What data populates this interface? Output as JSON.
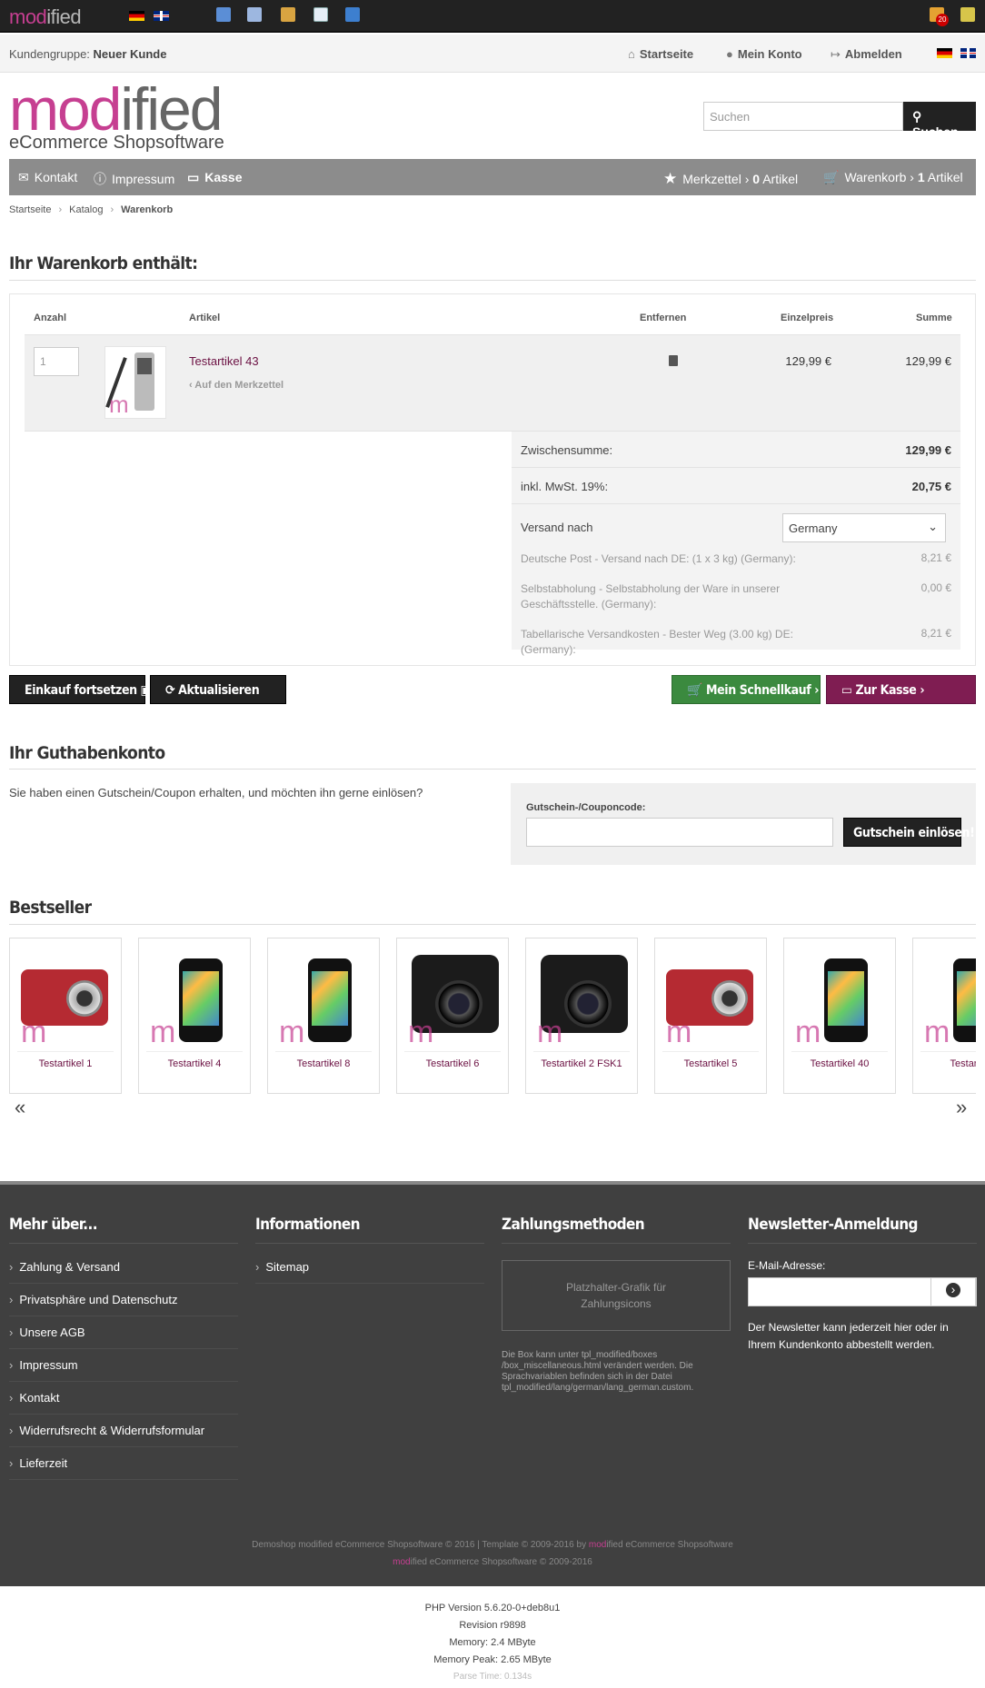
{
  "admin_bar": {
    "logo_left": "mod",
    "logo_right": "ified",
    "badge": "20"
  },
  "topbar": {
    "group_label": "Kundengruppe:",
    "group_value": "Neuer Kunde",
    "links": [
      "Startseite",
      "Mein Konto",
      "Abmelden"
    ]
  },
  "header": {
    "logo_main_a": "mod",
    "logo_main_b": "ified",
    "logo_sub": "eCommerce Shopsoftware",
    "search_placeholder": "Suchen",
    "search_button": "Suchen"
  },
  "nav": {
    "left": [
      "Kontakt",
      "Impressum",
      "Kasse"
    ],
    "merkzettel_label": "Merkzettel",
    "merkzettel_count": "0",
    "merkzettel_unit": "Artikel",
    "cart_label": "Warenkorb",
    "cart_count": "1",
    "cart_unit": "Artikel"
  },
  "breadcrumb": [
    "Startseite",
    "Katalog",
    "Warenkorb"
  ],
  "cart": {
    "title": "Ihr Warenkorb enthält:",
    "headers": {
      "qty": "Anzahl",
      "article": "Artikel",
      "remove": "Entfernen",
      "unit_price": "Einzelpreis",
      "sum": "Summe"
    },
    "item": {
      "qty": "1",
      "name": "Testartikel 43",
      "merkzettel_link": "‹ Auf den Merkzettel",
      "unit_price": "129,99 €",
      "sum": "129,99 €"
    },
    "subtotal_label": "Zwischensumme:",
    "subtotal_value": "129,99 €",
    "tax_label": "inkl. MwSt. 19%:",
    "tax_value": "20,75 €",
    "shipping_label": "Versand nach",
    "shipping_country": "Germany",
    "shipping_options": [
      {
        "text": "Deutsche Post - Versand nach DE: (1 x 3 kg) (Germany):",
        "value": "8,21 €"
      },
      {
        "text": "Selbstabholung - Selbstabholung der Ware in unserer Geschäftsstelle. (Germany):",
        "value": "0,00 €"
      },
      {
        "text": "Tabellarische Versandkosten - Bester Weg (3.00 kg) DE: (Germany):",
        "value": "8,21 €"
      }
    ]
  },
  "buttons": {
    "continue": "Einkauf fortsetzen",
    "update": "Aktualisieren",
    "quickbuy": "Mein Schnellkauf ›",
    "checkout": "Zur Kasse ›"
  },
  "coupon": {
    "title": "Ihr Guthabenkonto",
    "text": "Sie haben einen Gutschein/Coupon erhalten, und möchten ihn gerne einlösen?",
    "field_label": "Gutschein-/Couponcode:",
    "button": "Gutschein einlösen!"
  },
  "bestseller": {
    "title": "Bestseller",
    "items": [
      "Testartikel 1",
      "Testartikel 4",
      "Testartikel 8",
      "Testartikel 6",
      "Testartikel 2 FSK1",
      "Testartikel 5",
      "Testartikel 40",
      "Testartik"
    ],
    "prev": "«",
    "next": "»"
  },
  "footer": {
    "col1_title": "Mehr über...",
    "col1_links": [
      "Zahlung & Versand",
      "Privatsphäre und Datenschutz",
      "Unsere AGB",
      "Impressum",
      "Kontakt",
      "Widerrufsrecht & Widerrufsformular",
      "Lieferzeit"
    ],
    "col2_title": "Informationen",
    "col2_links": [
      "Sitemap"
    ],
    "col3_title": "Zahlungsmethoden",
    "pay_placeholder_1": "Platzhalter-Grafik für",
    "pay_placeholder_2": "Zahlungsicons",
    "pay_note": "Die Box kann unter tpl_modified/boxes /box_miscellaneous.html verändert werden. Die Sprachvariablen befinden sich in der Datei tpl_modified/lang/german/lang_german.custom.",
    "col4_title": "Newsletter-Anmeldung",
    "email_label": "E-Mail-Adresse:",
    "nl_note": "Der Newsletter kann jederzeit hier oder in Ihrem Kundenkonto abbestellt werden.",
    "copy1_a": "Demoshop modified eCommerce Shopsoftware © 2016 | Template © 2009-2016 by ",
    "copy1_b": "mod",
    "copy1_c": "ified eCommerce Shopsoftware",
    "copy2_a": "mod",
    "copy2_b": "ified eCommerce Shopsoftware © 2009-2016"
  },
  "debug": [
    "PHP Version 5.6.20-0+deb8u1",
    "Revision r9898",
    "Memory: 2.4 MByte",
    "Memory Peak: 2.65 MByte",
    "Parse Time: 0.134s"
  ]
}
